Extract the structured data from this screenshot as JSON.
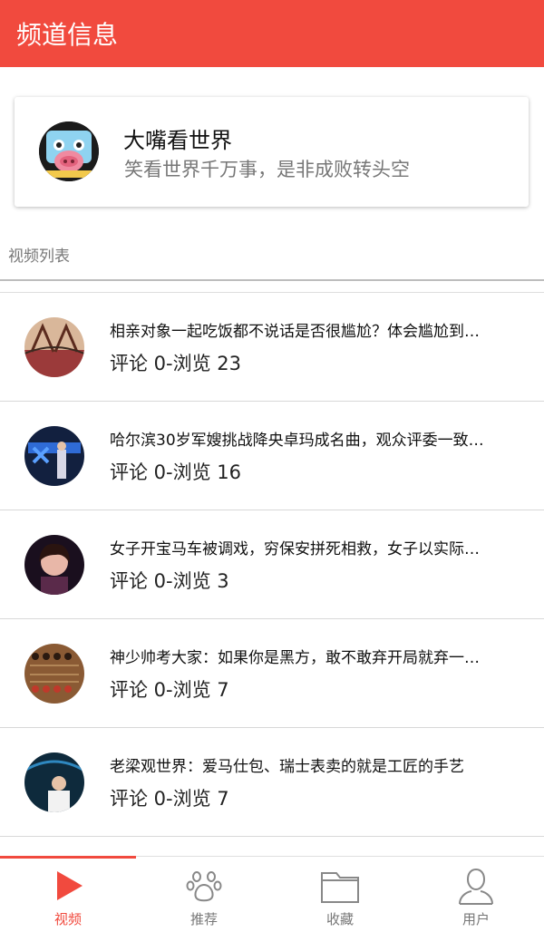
{
  "header": {
    "title": "频道信息"
  },
  "channel": {
    "name": "大嘴看世界",
    "slogan": "笑看世界千万事，是非成败转头空",
    "avatar_icon": "pig-face-avatar"
  },
  "section": {
    "label": "视频列表"
  },
  "videos": [
    {
      "title": "相亲对象一起吃饭都不说话是否很尴尬？体会尴尬到…",
      "stats": "评论 0-浏览 23",
      "thumb": "bridge-thumb"
    },
    {
      "title": "哈尔滨30岁军嫂挑战降央卓玛成名曲，观众评委一致…",
      "stats": "评论 0-浏览 16",
      "thumb": "stage-thumb"
    },
    {
      "title": "女子开宝马车被调戏，穷保安拼死相救，女子以实际…",
      "stats": "评论 0-浏览 3",
      "thumb": "woman-thumb"
    },
    {
      "title": "神少帅考大家：如果你是黑方，敢不敢弃开局就弃一…",
      "stats": "评论 0-浏览 7",
      "thumb": "chess-thumb"
    },
    {
      "title": "老梁观世界：爱马仕包、瑞士表卖的就是工匠的手艺",
      "stats": "评论 0-浏览 7",
      "thumb": "host-thumb"
    }
  ],
  "tabs": [
    {
      "label": "视频",
      "icon": "play-icon",
      "active": true
    },
    {
      "label": "推荐",
      "icon": "paw-icon",
      "active": false
    },
    {
      "label": "收藏",
      "icon": "folder-icon",
      "active": false
    },
    {
      "label": "用户",
      "icon": "user-icon",
      "active": false
    }
  ],
  "colors": {
    "accent": "#f14a3e",
    "muted": "#777777"
  }
}
